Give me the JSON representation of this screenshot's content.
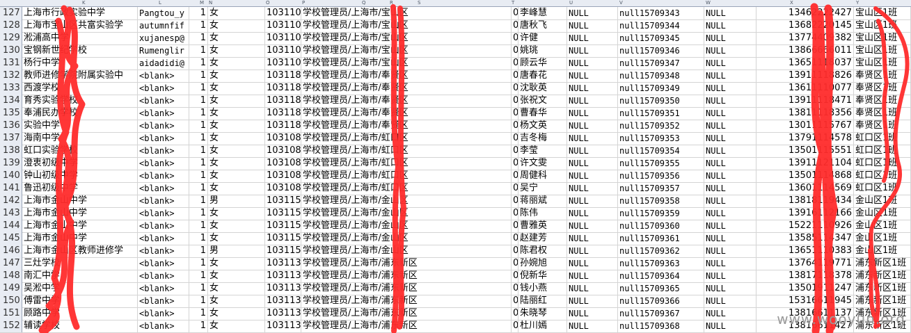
{
  "header_letters": [
    "K",
    "L",
    "M",
    "N",
    "O",
    "P",
    "Q",
    "R",
    "S",
    "T",
    "U",
    "V",
    "W",
    "X",
    "Y"
  ],
  "watermark": "www.wooyun.org",
  "annotation_color": "#ff2b2b",
  "rows": [
    {
      "n": "127",
      "school": "上海市行政实验中学",
      "email": "Pangtou_y",
      "num": "1",
      "sex": "女",
      "code": "103110",
      "role": "学校管理员/上海市/宝山区",
      "zero": "0",
      "name": "李峰慧",
      "n1": "NULL",
      "nid": "null15709343",
      "n2": "NULL",
      "phone": "13462222427",
      "cls": "宝山区1班"
    },
    {
      "n": "128",
      "school": "上海市宝山区共富实验学",
      "email": "autumnfif",
      "num": "1",
      "sex": "女",
      "code": "103110",
      "role": "学校管理员/上海市/宝山区",
      "zero": "0",
      "name": "唐秋飞",
      "n1": "NULL",
      "nid": "null15709344",
      "n2": "NULL",
      "phone": "13682220145",
      "cls": "宝山区1班"
    },
    {
      "n": "129",
      "school": "淞浦高中学",
      "email": "xujanesp@",
      "num": "1",
      "sex": "女",
      "code": "103110",
      "role": "学校管理员/上海市/宝山区",
      "zero": "0",
      "name": "许健",
      "n1": "NULL",
      "nid": "null15709345",
      "n2": "NULL",
      "phone": "13774409382",
      "cls": "宝山区1班"
    },
    {
      "n": "130",
      "school": "宝钢新世纪学校",
      "email": "Rumenglir",
      "num": "1",
      "sex": "女",
      "code": "103110",
      "role": "学校管理员/上海市/宝山区",
      "zero": "0",
      "name": "姚珧",
      "n1": "NULL",
      "nid": "null15709346",
      "n2": "NULL",
      "phone": "13866666011",
      "cls": "宝山区1班"
    },
    {
      "n": "131",
      "school": "杨行中学",
      "email": "aidadidi@",
      "num": "1",
      "sex": "女",
      "code": "103110",
      "role": "学校管理员/上海市/宝山区",
      "zero": "0",
      "name": "顾云华",
      "n1": "NULL",
      "nid": "null15709347",
      "n2": "NULL",
      "phone": "13651118037",
      "cls": "宝山区1班"
    },
    {
      "n": "132",
      "school": "教师进修学院附属实验中",
      "email": "<blank>",
      "num": "1",
      "sex": "女",
      "code": "103118",
      "role": "学校管理员/上海市/奉贤区",
      "zero": "0",
      "name": "唐春花",
      "n1": "NULL",
      "nid": "null15709348",
      "n2": "NULL",
      "phone": "13911118826",
      "cls": "奉贤区1班"
    },
    {
      "n": "133",
      "school": "西渡学校",
      "email": "<blank>",
      "num": "1",
      "sex": "女",
      "code": "103118",
      "role": "学校管理员/上海市/奉贤区",
      "zero": "0",
      "name": "沈耿英",
      "n1": "NULL",
      "nid": "null15709349",
      "n2": "NULL",
      "phone": "13611110077",
      "cls": "奉贤区1班"
    },
    {
      "n": "134",
      "school": "育秀实验学校",
      "email": "<blank>",
      "num": "1",
      "sex": "女",
      "code": "103118",
      "role": "学校管理员/上海市/奉贤区",
      "zero": "0",
      "name": "张祝文",
      "n1": "NULL",
      "nid": "null15709350",
      "n2": "NULL",
      "phone": "13911118471",
      "cls": "奉贤区1班"
    },
    {
      "n": "135",
      "school": "奉浦民办学校",
      "email": "<blank>",
      "num": "1",
      "sex": "女",
      "code": "103118",
      "role": "学校管理员/上海市/奉贤区",
      "zero": "0",
      "name": "曹春华",
      "n1": "NULL",
      "nid": "null15709351",
      "n2": "NULL",
      "phone": "13811118356",
      "cls": "奉贤区1班"
    },
    {
      "n": "136",
      "school": "实验中学",
      "email": "<blank>",
      "num": "1",
      "sex": "女",
      "code": "103118",
      "role": "学校管理员/上海市/奉贤区",
      "zero": "0",
      "name": "杨文英",
      "n1": "NULL",
      "nid": "null15709352",
      "n2": "NULL",
      "phone": "13011115767",
      "cls": "奉贤区1班"
    },
    {
      "n": "137",
      "school": "海南中学",
      "email": "<blank>",
      "num": "1",
      "sex": "女",
      "code": "103108",
      "role": "学校管理员/上海市/虹口区",
      "zero": "0",
      "name": "吉冬梅",
      "n1": "NULL",
      "nid": "null15709353",
      "n2": "NULL",
      "phone": "13791114578",
      "cls": "虹口区1班"
    },
    {
      "n": "138",
      "school": "虹口实验学校",
      "email": "<blank>",
      "num": "1",
      "sex": "女",
      "code": "103108",
      "role": "学校管理员/上海市/虹口区",
      "zero": "0",
      "name": "李莹",
      "n1": "NULL",
      "nid": "null15709354",
      "n2": "NULL",
      "phone": "13501115551",
      "cls": "虹口区1班"
    },
    {
      "n": "139",
      "school": "澄衷初级中学",
      "email": "<blank>",
      "num": "1",
      "sex": "女",
      "code": "103108",
      "role": "学校管理员/上海市/虹口区",
      "zero": "0",
      "name": "许文雯",
      "n1": "NULL",
      "nid": "null15709355",
      "n2": "NULL",
      "phone": "13911121104",
      "cls": "虹口区1班"
    },
    {
      "n": "140",
      "school": "钟山初级中学",
      "email": "<blank>",
      "num": "1",
      "sex": "女",
      "code": "103108",
      "role": "学校管理员/上海市/虹口区",
      "zero": "0",
      "name": "周健科",
      "n1": "NULL",
      "nid": "null15709356",
      "n2": "NULL",
      "phone": "13501114868",
      "cls": "虹口区1班"
    },
    {
      "n": "141",
      "school": "鲁迅初级中学",
      "email": "<blank>",
      "num": "1",
      "sex": "女",
      "code": "103108",
      "role": "学校管理员/上海市/虹口区",
      "zero": "0",
      "name": "吴宁",
      "n1": "NULL",
      "nid": "null15709357",
      "n2": "NULL",
      "phone": "13601114569",
      "cls": "虹口区1班"
    },
    {
      "n": "142",
      "school": "上海市金山中学",
      "email": "<blank>",
      "num": "1",
      "sex": "男",
      "code": "103115",
      "role": "学校管理员/上海市/金山区",
      "zero": "0",
      "name": "蒋丽斌",
      "n1": "NULL",
      "nid": "null15709358",
      "n2": "NULL",
      "phone": "13818119434",
      "cls": "金山区1班"
    },
    {
      "n": "143",
      "school": "上海市金山中学",
      "email": "<blank>",
      "num": "1",
      "sex": "女",
      "code": "103115",
      "role": "学校管理员/上海市/金山区",
      "zero": "0",
      "name": "陈伟",
      "n1": "NULL",
      "nid": "null15709359",
      "n2": "NULL",
      "phone": "13916112166",
      "cls": "金山区1班"
    },
    {
      "n": "144",
      "school": "上海市金山中学",
      "email": "<blank>",
      "num": "1",
      "sex": "女",
      "code": "103115",
      "role": "学校管理员/上海市/金山区",
      "zero": "0",
      "name": "曹雅英",
      "n1": "NULL",
      "nid": "null15709360",
      "n2": "NULL",
      "phone": "15221110926",
      "cls": "金山区1班"
    },
    {
      "n": "145",
      "school": "上海市金山中学",
      "email": "<blank>",
      "num": "1",
      "sex": "女",
      "code": "103115",
      "role": "学校管理员/上海市/金山区",
      "zero": "0",
      "name": "赵建芳",
      "n1": "NULL",
      "nid": "null15709361",
      "n2": "NULL",
      "phone": "13585114347",
      "cls": "金山区1班"
    },
    {
      "n": "146",
      "school": "上海市金山区教师进修学",
      "email": "<blank>",
      "num": "1",
      "sex": "男",
      "code": "103115",
      "role": "学校管理员/上海市/金山区",
      "zero": "0",
      "name": "陈君权",
      "n1": "NULL",
      "nid": "null15709362",
      "n2": "NULL",
      "phone": "13651110383",
      "cls": "金山区1班"
    },
    {
      "n": "147",
      "school": "三灶学校",
      "email": "<blank>",
      "num": "1",
      "sex": "女",
      "code": "103113",
      "role": "学校管理员/上海市/浦东新区",
      "zero": "0",
      "name": "孙婉旭",
      "n1": "NULL",
      "nid": "null15709363",
      "n2": "NULL",
      "phone": "13764119771",
      "cls": "浦东新区1班"
    },
    {
      "n": "148",
      "school": "南汇中学",
      "email": "<blank>",
      "num": "1",
      "sex": "女",
      "code": "103113",
      "role": "学校管理员/上海市/浦东新区",
      "zero": "0",
      "name": "倪新华",
      "n1": "NULL",
      "nid": "null15709364",
      "n2": "NULL",
      "phone": "13817118378",
      "cls": "浦东新区1班"
    },
    {
      "n": "149",
      "school": "吴淞中学",
      "email": "<blank>",
      "num": "1",
      "sex": "女",
      "code": "103113",
      "role": "学校管理员/上海市/浦东新区",
      "zero": "0",
      "name": "钱小燕",
      "n1": "NULL",
      "nid": "null15709365",
      "n2": "NULL",
      "phone": "13501911247",
      "cls": "浦东新区1班"
    },
    {
      "n": "150",
      "school": "傅雷中学",
      "email": "<blank>",
      "num": "1",
      "sex": "女",
      "code": "103113",
      "role": "学校管理员/上海市/浦东新区",
      "zero": "0",
      "name": "陆丽红",
      "n1": "NULL",
      "nid": "null15709366",
      "n2": "NULL",
      "phone": "15316611945",
      "cls": "浦东新区1班"
    },
    {
      "n": "151",
      "school": "顾路中学",
      "email": "<blank>",
      "num": "1",
      "sex": "女",
      "code": "103113",
      "role": "学校管理员/上海市/浦东新区",
      "zero": "0",
      "name": "朱晓琴",
      "n1": "NULL",
      "nid": "null15709367",
      "n2": "NULL",
      "phone": "13816611137",
      "cls": "浦东新区1班"
    },
    {
      "n": "152",
      "school": "辅读学校",
      "email": "<blank>",
      "num": "1",
      "sex": "女",
      "code": "103113",
      "role": "学校管理员/上海市/浦东新区",
      "zero": "0",
      "name": "杜川嫣",
      "n1": "NULL",
      "nid": "null15709368",
      "n2": "NULL",
      "phone": "13816611427",
      "cls": "浦东新区1班"
    }
  ]
}
